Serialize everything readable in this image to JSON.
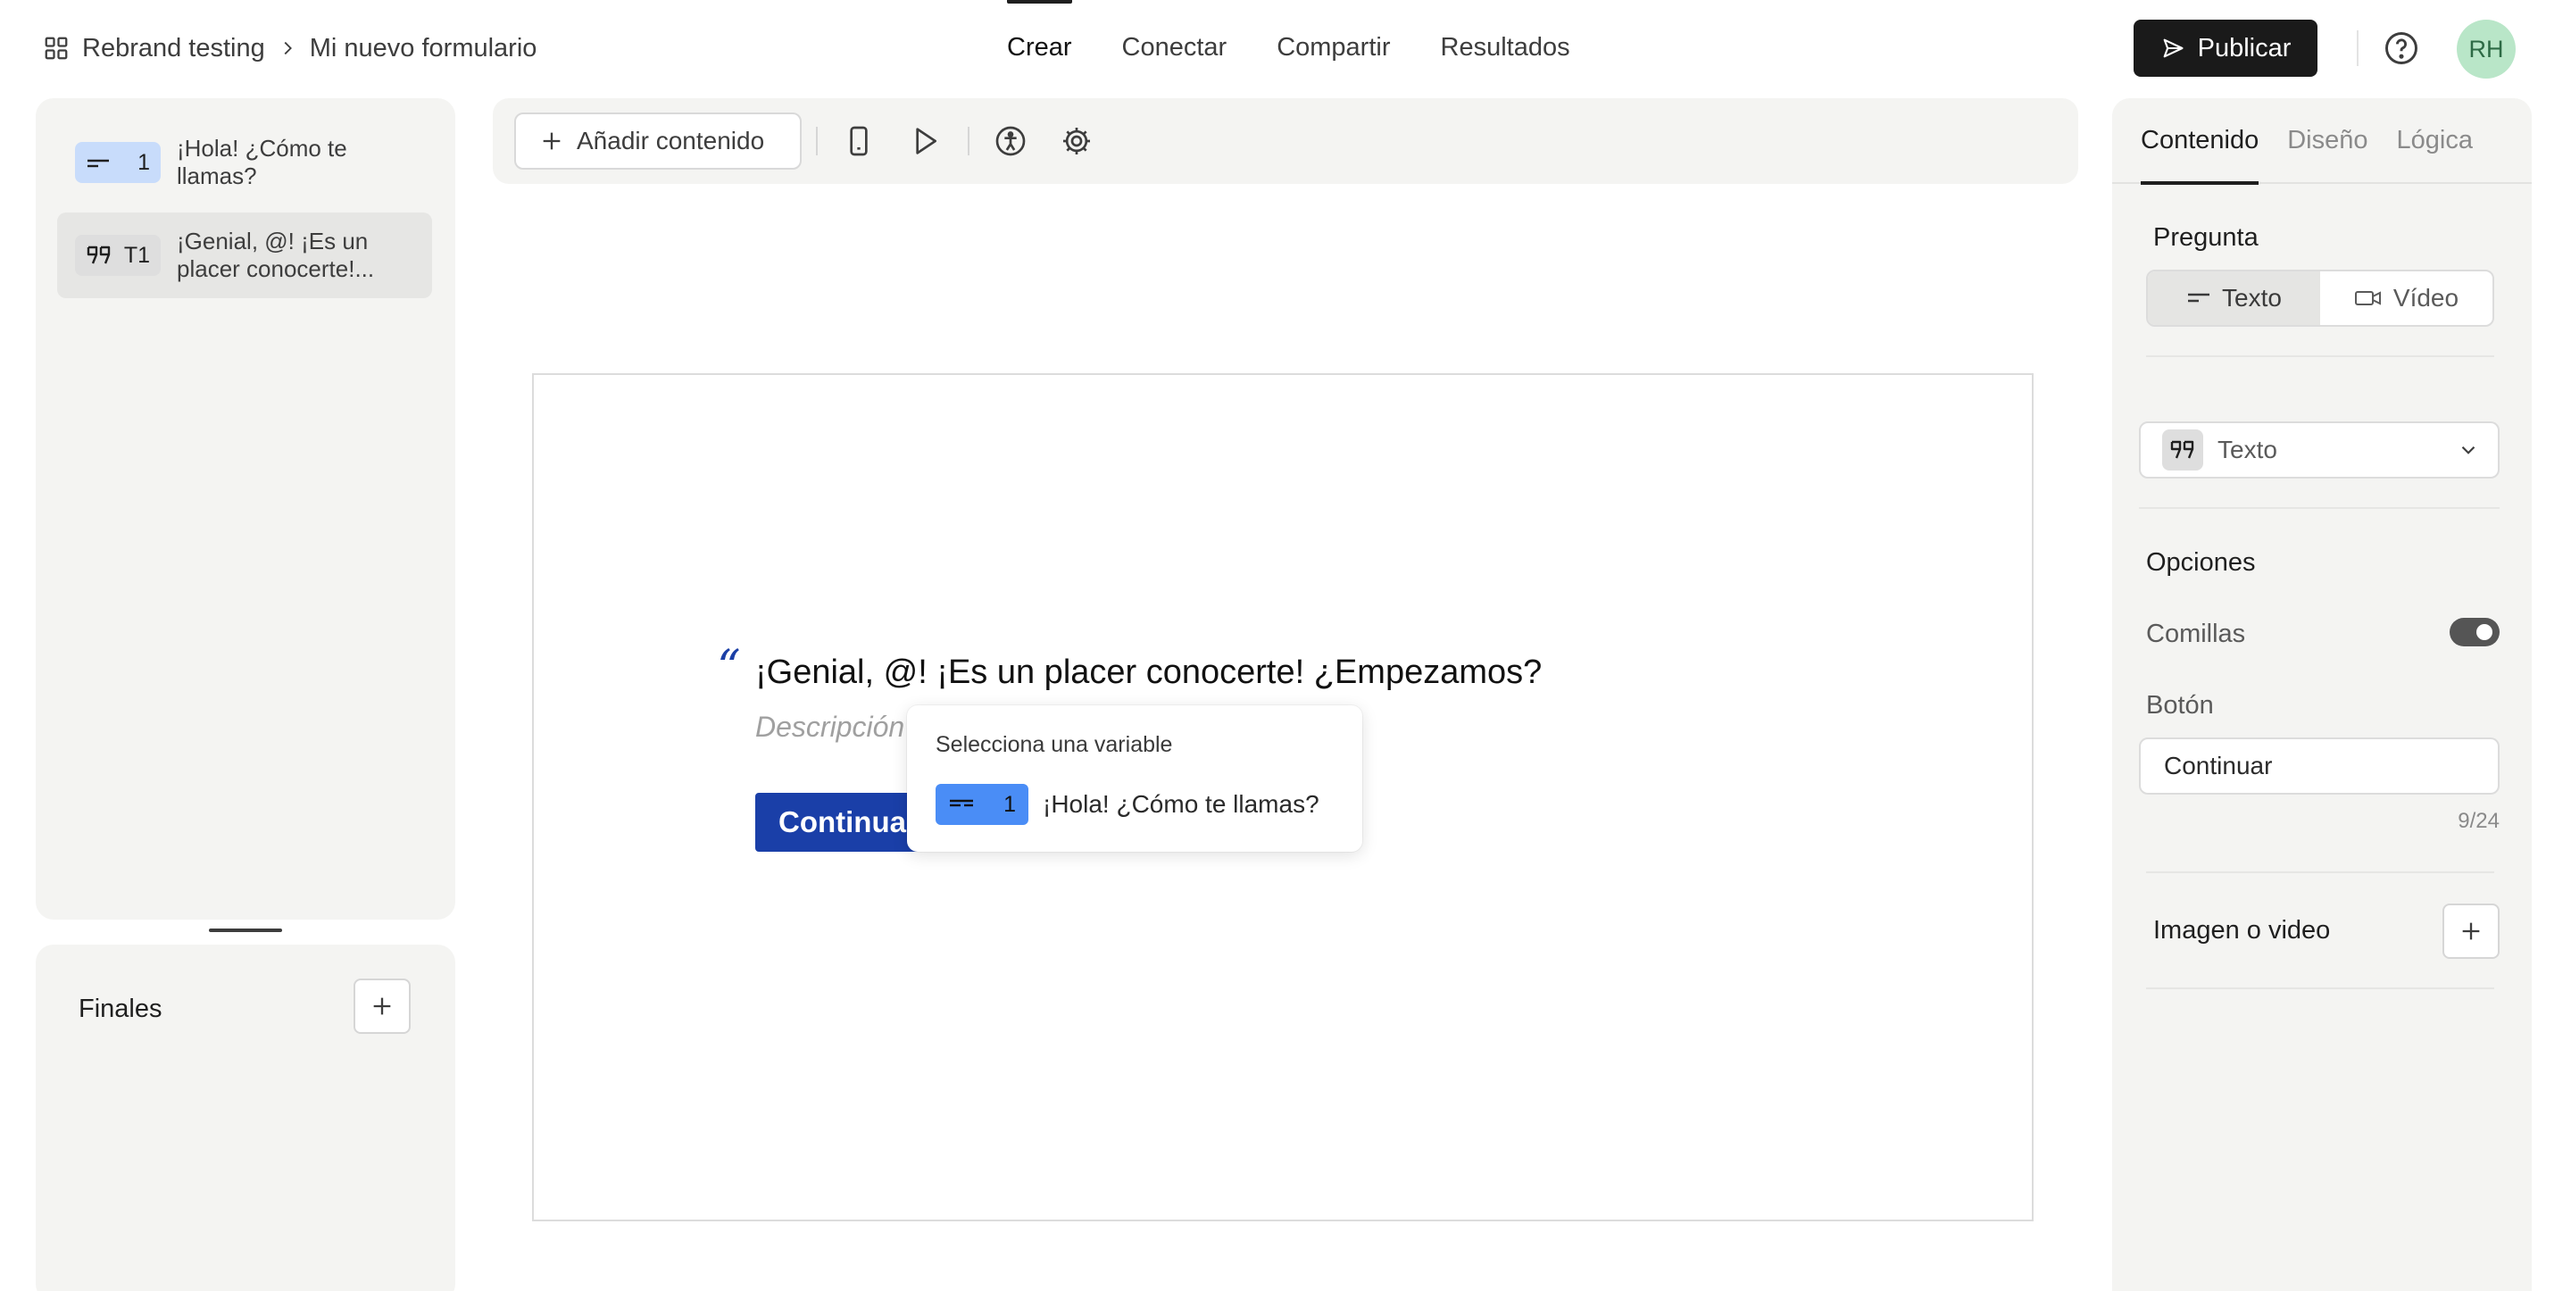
{
  "breadcrumb": {
    "workspace": "Rebrand testing",
    "form": "Mi nuevo formulario"
  },
  "nav": {
    "tabs": [
      "Crear",
      "Conectar",
      "Compartir",
      "Resultados"
    ],
    "active": "Crear"
  },
  "header": {
    "publish_label": "Publicar",
    "avatar_initials": "RH"
  },
  "sidebar": {
    "items": [
      {
        "number": "1",
        "text": "¡Hola! ¿Cómo te llamas?",
        "icon": "short-text-icon"
      },
      {
        "number": "T1",
        "text": "¡Genial, @!  ¡Es un placer conocerte!...",
        "icon": "quote-icon"
      }
    ],
    "endings_label": "Finales"
  },
  "toolbar": {
    "add_content_label": "Añadir contenido"
  },
  "canvas": {
    "quote_mark": "“",
    "title": "¡Genial, @!  ¡Es un placer conocerte! ¿Empezamos?",
    "description_placeholder": "Descripción",
    "button_label": "Continuar"
  },
  "variable_popup": {
    "title": "Selecciona una variable",
    "option_number": "1",
    "option_text": "¡Hola! ¿Cómo te llamas?"
  },
  "panel": {
    "tabs": [
      "Contenido",
      "Diseño",
      "Lógica"
    ],
    "active_tab": "Contenido",
    "question_label": "Pregunta",
    "segment": [
      "Texto",
      "Vídeo"
    ],
    "segment_selected": "Texto",
    "type_value": "Texto",
    "options_label": "Opciones",
    "quotes_label": "Comillas",
    "quotes_on": true,
    "button_label": "Botón",
    "button_value": "Continuar",
    "button_counter": "9/24",
    "media_label": "Imagen o video"
  },
  "colors": {
    "accent_blue": "#1a3fa8",
    "badge_blue": "#c8dcfb",
    "popup_badge": "#4a8df6",
    "avatar": "#b9e6c8"
  }
}
